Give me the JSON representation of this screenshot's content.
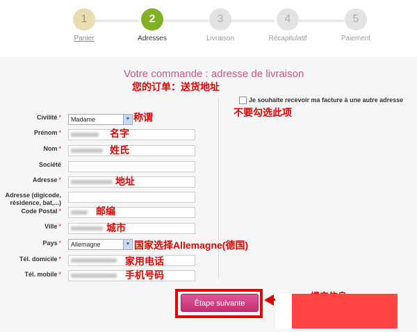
{
  "stepper": {
    "steps": [
      {
        "number": "1",
        "label": "Panier"
      },
      {
        "number": "2",
        "label": "Adresses"
      },
      {
        "number": "3",
        "label": "Livraison"
      },
      {
        "number": "4",
        "label": "Récapitulatif"
      },
      {
        "number": "5",
        "label": "Paiement"
      }
    ]
  },
  "form": {
    "title": "Votre commande : adresse de livraison",
    "title_annotation": "您的订单：送货地址",
    "checkbox_label": "Je souhaite recevoir ma facture à une autre adresse",
    "checkbox_annotation": "不要勾选此项",
    "fields": {
      "civilite": {
        "label": "Civilité",
        "value": "Madame",
        "annotation": "称谓"
      },
      "prenom": {
        "label": "Prénom",
        "annotation": "名字"
      },
      "nom": {
        "label": "Nom",
        "annotation": "姓氏"
      },
      "societe": {
        "label": "Société"
      },
      "adresse": {
        "label": "Adresse",
        "annotation": "地址"
      },
      "adresse2": {
        "label": "Adresse (digicode, résidence, bat,...)"
      },
      "code_postal": {
        "label": "Code Postal",
        "annotation": "邮编"
      },
      "ville": {
        "label": "Ville",
        "annotation": "城市"
      },
      "pays": {
        "label": "Pays",
        "value": "Allemagne",
        "annotation": "国家选择Allemagne(德国)"
      },
      "tel_domicile": {
        "label": "Tél. domicile",
        "annotation": "家用电话"
      },
      "tel_mobile": {
        "label": "Tél. mobile",
        "annotation": "手机号码"
      }
    },
    "required_mark": "*",
    "submit_label": "Étape suivante",
    "submit_annotation": "提交信息"
  }
}
